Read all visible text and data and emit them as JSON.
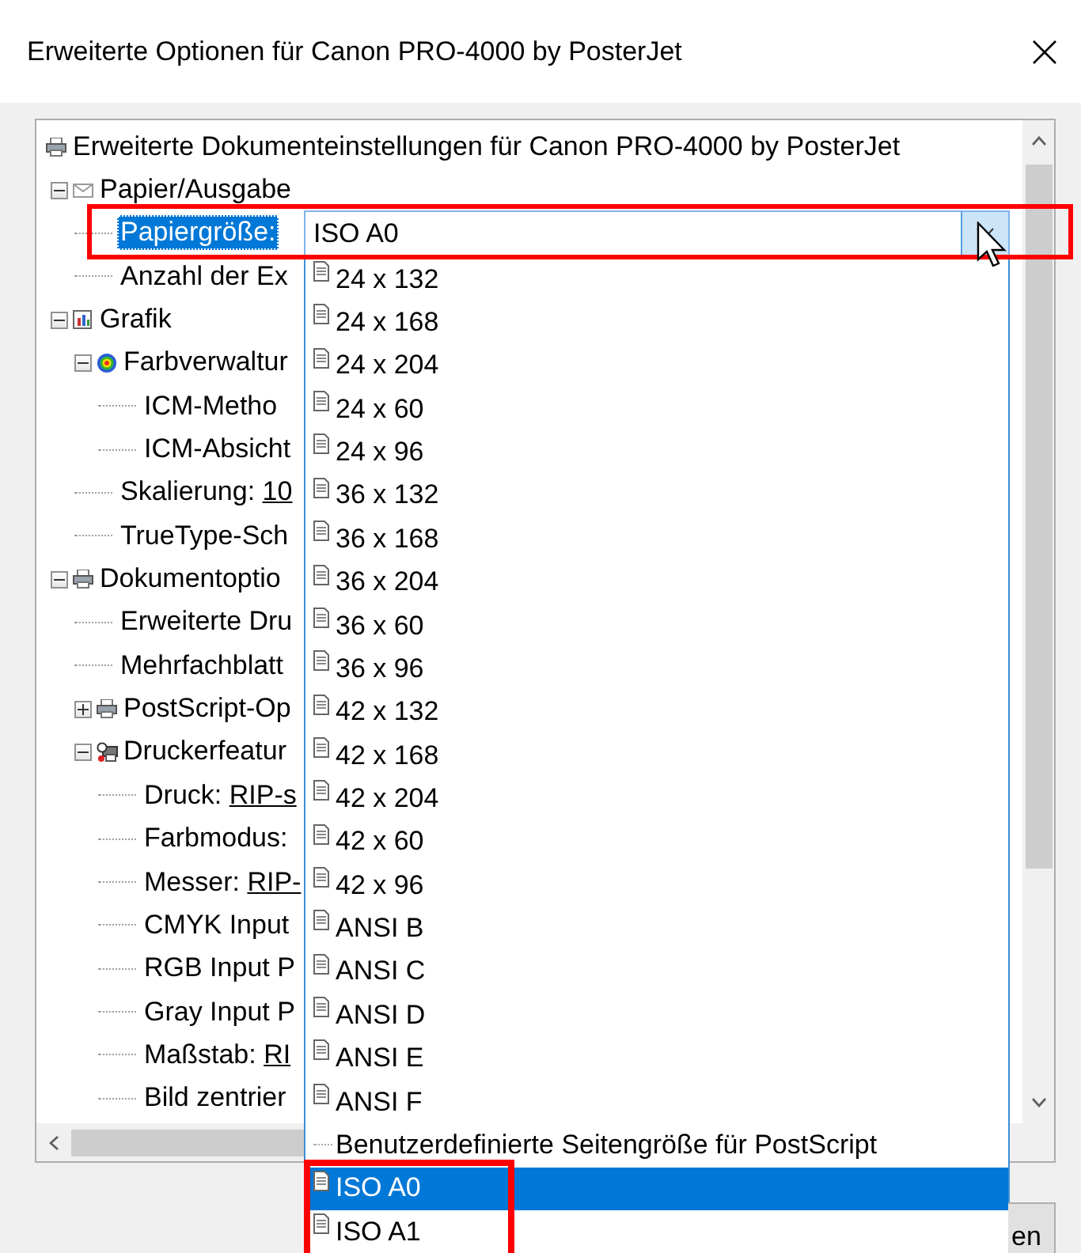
{
  "window": {
    "title": "Erweiterte Optionen für Canon PRO-4000 by PosterJet"
  },
  "tree": {
    "label": "Erweiterte Dokumenteinstellungen für Canon PRO-4000 by PosterJet",
    "kind": "printer",
    "selected": false,
    "children": [
      {
        "label": "Papier/Ausgabe",
        "kind": "paper",
        "expanded": true,
        "selected": false,
        "children": [
          {
            "label": "Papiergröße:",
            "kind": "setting",
            "selected": true
          },
          {
            "label": "Anzahl der Ex",
            "kind": "setting",
            "selected": false
          }
        ]
      },
      {
        "label": "Grafik",
        "kind": "graphic",
        "expanded": true,
        "selected": false,
        "children": [
          {
            "label": "Farbverwaltur",
            "kind": "color",
            "expanded": true,
            "selected": false,
            "children": [
              {
                "label": "ICM-Metho",
                "kind": "setting",
                "selected": false
              },
              {
                "label": "ICM-Absicht",
                "kind": "setting",
                "selected": false
              }
            ]
          },
          {
            "label": "Skalierung:",
            "value": "10",
            "kind": "setting",
            "selected": false
          },
          {
            "label": "TrueType-Sch",
            "kind": "setting",
            "selected": false
          }
        ]
      },
      {
        "label": "Dokumentoptio",
        "kind": "printer",
        "expanded": true,
        "selected": false,
        "children": [
          {
            "label": "Erweiterte Dru",
            "kind": "setting",
            "selected": false
          },
          {
            "label": "Mehrfachblatt",
            "kind": "setting",
            "selected": false
          },
          {
            "label": "PostScript-Op",
            "kind": "printer",
            "expanded": false,
            "selected": false
          },
          {
            "label": "Druckerfeatur",
            "kind": "features",
            "expanded": true,
            "selected": false,
            "children": [
              {
                "label": "Druck:",
                "value": "RIP-s",
                "kind": "setting",
                "selected": false
              },
              {
                "label": "Farbmodus:",
                "kind": "setting",
                "selected": false
              },
              {
                "label": "Messer:",
                "value": "RIP-",
                "kind": "setting",
                "selected": false
              },
              {
                "label": "CMYK Input",
                "kind": "setting",
                "selected": false
              },
              {
                "label": "RGB Input P",
                "kind": "setting",
                "selected": false
              },
              {
                "label": "Gray Input P",
                "kind": "setting",
                "selected": false
              },
              {
                "label": "Maßstab:",
                "value": "RI",
                "kind": "setting",
                "selected": false
              },
              {
                "label": "Bild zentrier",
                "kind": "setting",
                "selected": false
              }
            ]
          }
        ]
      }
    ]
  },
  "combo": {
    "value": "ISO A0",
    "highlighted": true,
    "expanded": true,
    "options": [
      {
        "label": "24 x 132",
        "kind": "page",
        "selected": false,
        "highlighted": false
      },
      {
        "label": "24 x 168",
        "kind": "page",
        "selected": false,
        "highlighted": false
      },
      {
        "label": "24 x 204",
        "kind": "page",
        "selected": false,
        "highlighted": false
      },
      {
        "label": "24 x 60",
        "kind": "page",
        "selected": false,
        "highlighted": false
      },
      {
        "label": "24 x 96",
        "kind": "page",
        "selected": false,
        "highlighted": false
      },
      {
        "label": "36 x 132",
        "kind": "page",
        "selected": false,
        "highlighted": false
      },
      {
        "label": "36 x 168",
        "kind": "page",
        "selected": false,
        "highlighted": false
      },
      {
        "label": "36 x 204",
        "kind": "page",
        "selected": false,
        "highlighted": false
      },
      {
        "label": "36 x 60",
        "kind": "page",
        "selected": false,
        "highlighted": false
      },
      {
        "label": "36 x 96",
        "kind": "page",
        "selected": false,
        "highlighted": false
      },
      {
        "label": "42 x 132",
        "kind": "page",
        "selected": false,
        "highlighted": false
      },
      {
        "label": "42 x 168",
        "kind": "page",
        "selected": false,
        "highlighted": false
      },
      {
        "label": "42 x 204",
        "kind": "page",
        "selected": false,
        "highlighted": false
      },
      {
        "label": "42 x 60",
        "kind": "page",
        "selected": false,
        "highlighted": false
      },
      {
        "label": "42 x 96",
        "kind": "page",
        "selected": false,
        "highlighted": false
      },
      {
        "label": "ANSI B",
        "kind": "page",
        "selected": false,
        "highlighted": false
      },
      {
        "label": "ANSI C",
        "kind": "page",
        "selected": false,
        "highlighted": false
      },
      {
        "label": "ANSI D",
        "kind": "page",
        "selected": false,
        "highlighted": false
      },
      {
        "label": "ANSI E",
        "kind": "page",
        "selected": false,
        "highlighted": false
      },
      {
        "label": "ANSI F",
        "kind": "page",
        "selected": false,
        "highlighted": false
      },
      {
        "label": "Benutzerdefinierte Seitengröße für PostScript",
        "kind": "custom",
        "selected": false,
        "highlighted": false
      },
      {
        "label": "ISO A0",
        "kind": "page",
        "selected": true,
        "highlighted": true
      },
      {
        "label": "ISO A1",
        "kind": "page",
        "selected": false,
        "highlighted": true
      }
    ]
  },
  "button": {
    "label": "en"
  }
}
